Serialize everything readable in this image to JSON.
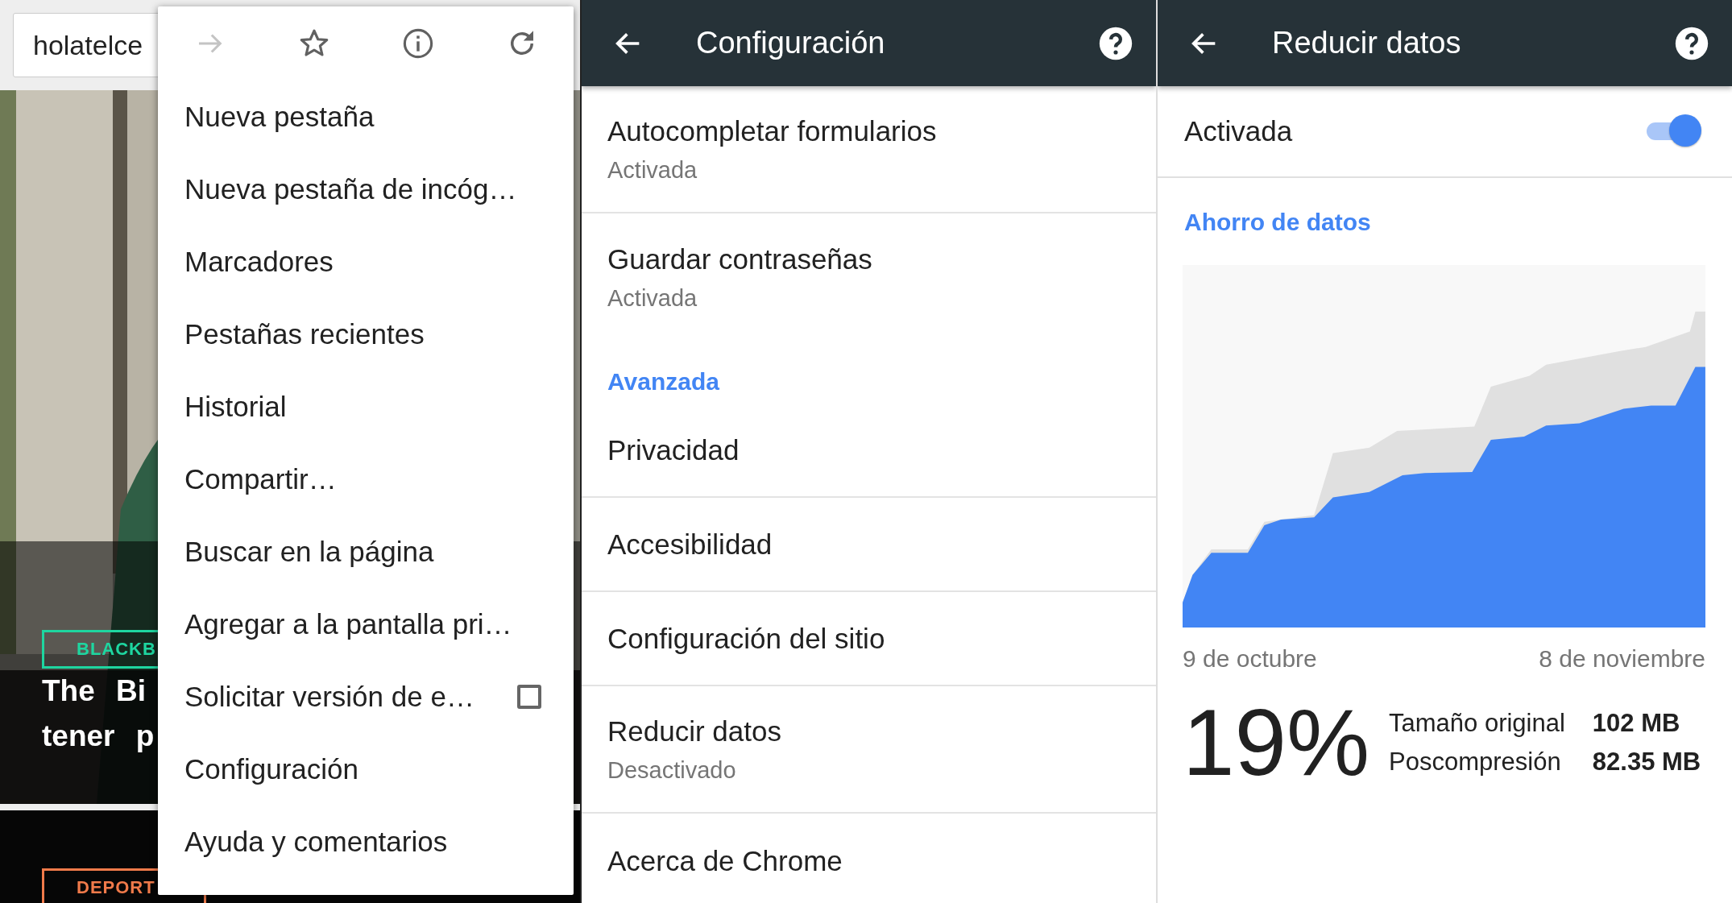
{
  "browser": {
    "url": "holatelce",
    "page": {
      "tag": "BLACKB",
      "headline": [
        "The Bi",
        "tener p"
      ],
      "section_tag": "DEPORT"
    },
    "menu": {
      "toolbar": [
        {
          "kind": "forward",
          "disabled": true
        },
        {
          "kind": "bookmark",
          "disabled": false
        },
        {
          "kind": "info",
          "disabled": false
        },
        {
          "kind": "reload",
          "disabled": false
        }
      ],
      "items": [
        {
          "kind": "plain",
          "label": "Nueva pestaña"
        },
        {
          "kind": "plain",
          "label": "Nueva pestaña de incóg…"
        },
        {
          "kind": "plain",
          "label": "Marcadores"
        },
        {
          "kind": "plain",
          "label": "Pestañas recientes"
        },
        {
          "kind": "plain",
          "label": "Historial"
        },
        {
          "kind": "plain",
          "label": "Compartir…"
        },
        {
          "kind": "plain",
          "label": "Buscar en la página"
        },
        {
          "kind": "plain",
          "label": "Agregar a la pantalla pri…"
        },
        {
          "kind": "checkbox",
          "label": "Solicitar versión de e…",
          "checked": false
        },
        {
          "kind": "plain",
          "label": "Configuración"
        },
        {
          "kind": "plain",
          "label": "Ayuda y comentarios"
        }
      ]
    }
  },
  "settings": {
    "title": "Configuración",
    "items": [
      {
        "kind": "item",
        "title": "Autocompletar formularios",
        "subtitle": "Activada"
      },
      {
        "kind": "item",
        "title": "Guardar contraseñas",
        "subtitle": "Activada"
      },
      {
        "kind": "header",
        "title": "Avanzada"
      },
      {
        "kind": "item",
        "title": "Privacidad"
      },
      {
        "kind": "item",
        "title": "Accesibilidad"
      },
      {
        "kind": "item",
        "title": "Configuración del sitio"
      },
      {
        "kind": "item",
        "title": "Reducir datos",
        "subtitle": "Desactivado"
      },
      {
        "kind": "item",
        "title": "Acerca de Chrome"
      }
    ]
  },
  "reduce_data": {
    "title": "Reducir datos",
    "switch": {
      "label": "Activada",
      "on": true
    },
    "section": "Ahorro de datos",
    "chart": {
      "start_label": "9 de octubre",
      "end_label": "8 de noviembre"
    },
    "savings": "19%",
    "stats": [
      {
        "label": "Tamaño original",
        "value": "102 MB"
      },
      {
        "label": "Poscompresión",
        "value": "82.35 MB"
      }
    ]
  }
}
